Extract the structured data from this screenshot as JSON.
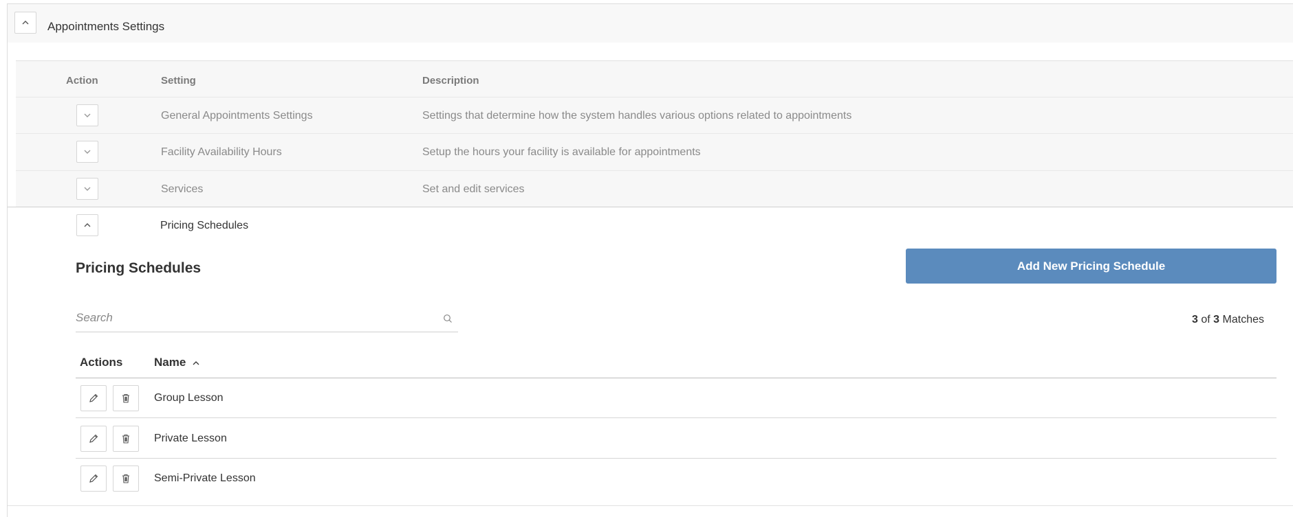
{
  "panel": {
    "title": "Appointments Settings"
  },
  "settings_table": {
    "columns": {
      "action": "Action",
      "setting": "Setting",
      "description": "Description"
    },
    "rows": [
      {
        "name": "General Appointments Settings",
        "description": "Settings that determine how the system handles various options related to appointments"
      },
      {
        "name": "Facility Availability Hours",
        "description": "Setup the hours your facility is available for appointments"
      },
      {
        "name": "Services",
        "description": "Set and edit services"
      }
    ],
    "expanded": {
      "name": "Pricing Schedules"
    }
  },
  "pricing": {
    "title": "Pricing Schedules",
    "add_button": "Add New Pricing Schedule",
    "search_placeholder": "Search",
    "matches": {
      "shown": "3",
      "of_label": "of",
      "total": "3",
      "label": "Matches"
    },
    "columns": {
      "actions": "Actions",
      "name": "Name"
    },
    "rows": [
      {
        "name": "Group Lesson"
      },
      {
        "name": "Private Lesson"
      },
      {
        "name": "Semi-Private Lesson"
      }
    ]
  },
  "colors": {
    "primary_button": "#5b8bbd",
    "panel_bg": "#f8f8f8",
    "muted_text": "#8a8a8a"
  },
  "icons": {
    "collapse": "chevron-up-icon",
    "expand": "chevron-down-icon",
    "search": "search-icon",
    "edit": "pencil-icon",
    "delete": "trash-icon",
    "sort": "sort-ascending-icon"
  }
}
